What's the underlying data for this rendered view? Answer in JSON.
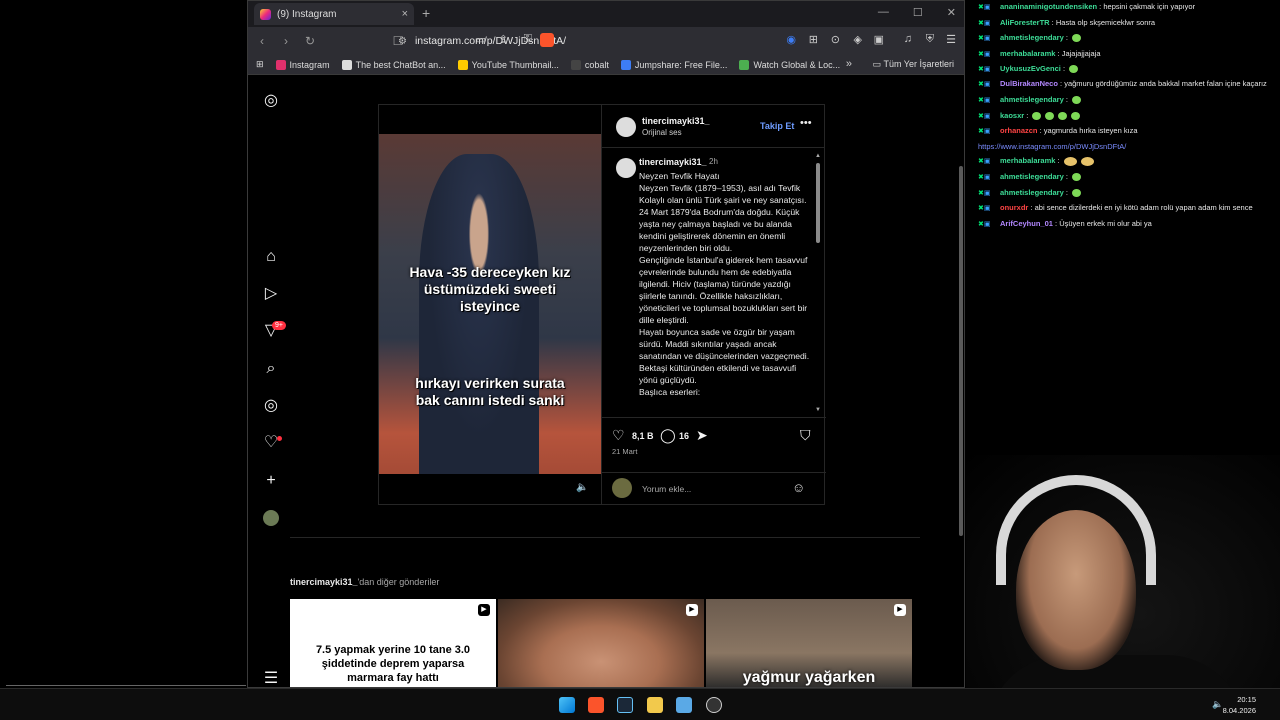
{
  "browser": {
    "tab_title": "(9) Instagram",
    "tab_close": "×",
    "new_tab": "+",
    "url": "instagram.com/p/DWJjDsnDFtA/",
    "window_controls": [
      "—",
      "☐",
      "✕"
    ],
    "bookmarks": [
      {
        "label": "Instagram",
        "color": "#e1306c"
      },
      {
        "label": "The best ChatBot an...",
        "color": "#dddddd"
      },
      {
        "label": "YouTube Thumbnail...",
        "color": "#ffcc00"
      },
      {
        "label": "cobalt",
        "color": "#222222"
      },
      {
        "label": "Jumpshare: Free File...",
        "color": "#3d7df5"
      },
      {
        "label": "Watch Global & Loc...",
        "color": "#4caf50"
      }
    ],
    "bookmarks_more": "»",
    "all_bookmarks": "Tüm Yer İşaretleri"
  },
  "post": {
    "username": "tinercimayki31_",
    "audio": "Orijinal ses",
    "follow": "Takip Et",
    "more": "•••",
    "time": "2h",
    "video_caption_top": [
      "Hava -35 dereceyken kız",
      "üstümüzdeki sweeti",
      "isteyince"
    ],
    "video_caption_bottom": [
      "hırkayı verirken surata",
      "bak canını istedi sanki"
    ],
    "caption": "Neyzen Tevfik Hayatı\nNeyzen Tevfik (1879–1953), asıl adı Tevfik Kolaylı olan ünlü Türk şairi ve ney sanatçısı. 24 Mart 1879'da Bodrum'da doğdu. Küçük yaşta ney çalmaya başladı ve bu alanda kendini geliştirerek dönemin en önemli neyzenlerinden biri oldu.\nGençliğinde İstanbul'a giderek hem tasavvuf çevrelerinde bulundu hem de edebiyatla ilgilendi. Hiciv (taşlama) türünde yazdığı şiirlerle tanındı. Özellikle haksızlıkları, yöneticileri ve toplumsal bozuklukları sert bir dille eleştirdi.\nHayatı boyunca sade ve özgür bir yaşam sürdü. Maddi sıkıntılar yaşadı ancak sanatından ve düşüncelerinden vazgeçmedi. Bektaşi kültüründen etkilendi ve tasavvufi yönü güçlüydü.\nBaşlıca eserleri:",
    "likes": "8,1 B",
    "comments": "16",
    "date": "21 Mart",
    "comment_placeholder": "Yorum ekle..."
  },
  "more_from": {
    "user": "tinercimayki31_",
    "suffix": "'dan diğer gönderiler",
    "thumbs": [
      {
        "text": "7.5 yapmak yerine 10 tane 3.0 şiddetinde deprem yaparsa marmara fay hattı"
      },
      {
        "text": ""
      },
      {
        "text": "yağmur yağarken"
      }
    ]
  },
  "sidebar": {
    "notifications_badge": "9+"
  },
  "chat": [
    {
      "user": "ananinaminigotundensiken",
      "color": "#3ddc97",
      "msg": "hepsini çakmak için yapıyor",
      "emotes": 0
    },
    {
      "user": "AliForesterTR",
      "color": "#3ddc97",
      "msg": "Hasta olp skşemiceklwr sonra",
      "emotes": 0
    },
    {
      "user": "ahmetislegendary",
      "color": "#3ddc97",
      "msg": "",
      "emotes": 1
    },
    {
      "user": "merhabalaramk",
      "color": "#3ddc97",
      "msg": "Jajajajjajaja",
      "emotes": 0
    },
    {
      "user": "UykusuzEvGenci",
      "color": "#3ddc97",
      "msg": "",
      "emotes": 1
    },
    {
      "user": "DulBirakanNeco",
      "color": "#b388ff",
      "msg": "yağmuru gördüğümüz anda bakkal market falan içine kaçarız",
      "emotes": 0
    },
    {
      "user": "ahmetislegendary",
      "color": "#3ddc97",
      "msg": "",
      "emotes": 1
    },
    {
      "user": "kaosxr",
      "color": "#3ddc97",
      "msg": "",
      "emotes": 4
    },
    {
      "user": "orhanazcn",
      "color": "#ff4444",
      "msg": "yagmurda hırka isteyen kıza",
      "emotes": 0
    },
    {
      "user": "",
      "color": "#7a8cff",
      "msg": "https://www.instagram.com/p/DWJjDsnDFtA/",
      "emotes": 0,
      "link": true
    },
    {
      "user": "merhabalaramk",
      "color": "#3ddc97",
      "msg": "",
      "emotes": 2,
      "big": true
    },
    {
      "user": "ahmetislegendary",
      "color": "#3ddc97",
      "msg": "",
      "emotes": 1
    },
    {
      "user": "ahmetislegendary",
      "color": "#3ddc97",
      "msg": "",
      "emotes": 1
    },
    {
      "user": "onurxdr",
      "color": "#ff4444",
      "msg": "abi sence dizilerdeki en iyi kötü adam rolü yapan adam kim sence",
      "emotes": 0
    },
    {
      "user": "ArifCeyhun_01",
      "color": "#b388ff",
      "msg": "Üşüyen erkek mi olur abi ya",
      "emotes": 0
    }
  ],
  "taskbar": {
    "time": "20:15",
    "date": "8.04.2026"
  },
  "colors": {
    "link": "#6e9cff",
    "badge": "#ff3040",
    "background": "#000000"
  }
}
